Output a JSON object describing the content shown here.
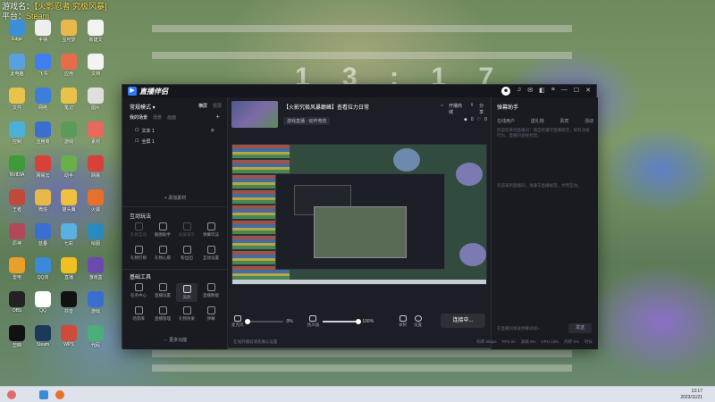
{
  "desktop": {
    "title_line1_label": "游戏名：",
    "title_line1_value": "【火影忍者 究极风暴]",
    "title_line2_label": "平台：",
    "title_line2_value": "Steam",
    "clock": "1 3 : 1 7",
    "icons": [
      {
        "label": "Edge",
        "color": "#3b8ed8"
      },
      {
        "label": "手柄",
        "color": "#eeeeee"
      },
      {
        "label": "宝可梦",
        "color": "#e8b94a"
      },
      {
        "label": "新建文",
        "color": "#f3f3f3"
      },
      {
        "label": "此电脑",
        "color": "#5aa0e0"
      },
      {
        "label": "飞书",
        "color": "#3f7ef0"
      },
      {
        "label": "应用",
        "color": "#e56b4a"
      },
      {
        "label": "文档",
        "color": "#f3f3f3"
      },
      {
        "label": "文件",
        "color": "#e8c24a"
      },
      {
        "label": "网络",
        "color": "#3d7fd8"
      },
      {
        "label": "笔记",
        "color": "#e8c24a"
      },
      {
        "label": "图片",
        "color": "#e0e0e0"
      },
      {
        "label": "控制",
        "color": "#4ab0d8"
      },
      {
        "label": "应用商",
        "color": "#3a6fd0"
      },
      {
        "label": "游戏",
        "color": "#5b9b5a"
      },
      {
        "label": "素材",
        "color": "#e86a5a"
      },
      {
        "label": "NVIDIA",
        "color": "#3e9a3a"
      },
      {
        "label": "网易云",
        "color": "#d8403a"
      },
      {
        "label": "助手",
        "color": "#6ab04a"
      },
      {
        "label": "网易",
        "color": "#d8403a"
      },
      {
        "label": "王者",
        "color": "#c04a3a"
      },
      {
        "label": "微信",
        "color": "#e8b94a"
      },
      {
        "label": "猫头鹰",
        "color": "#f0c040"
      },
      {
        "label": "火狐",
        "color": "#e8702a"
      },
      {
        "label": "原神",
        "color": "#b04a5a"
      },
      {
        "label": "蓝叠",
        "color": "#3a6fd0"
      },
      {
        "label": "七彩",
        "color": "#5ab0e0"
      },
      {
        "label": "绘图",
        "color": "#2a8ac0"
      },
      {
        "label": "雷电",
        "color": "#e8a02a"
      },
      {
        "label": "QQ浏",
        "color": "#3a8ad8"
      },
      {
        "label": "直播",
        "color": "#f0c020"
      },
      {
        "label": "游戏盒",
        "color": "#6a4ab0"
      },
      {
        "label": "OBS",
        "color": "#222222"
      },
      {
        "label": "QQ",
        "color": "#ffffff"
      },
      {
        "label": "抖音",
        "color": "#111111"
      },
      {
        "label": "游戏",
        "color": "#3a6fd0"
      },
      {
        "label": "剪映",
        "color": "#111111"
      },
      {
        "label": "Steam",
        "color": "#1b3a5a"
      },
      {
        "label": "WPS",
        "color": "#d04a3a"
      },
      {
        "label": "代码",
        "color": "#4ab07a"
      }
    ]
  },
  "app": {
    "name": "直播伴侣",
    "left": {
      "mode_label": "常规模式 ▾",
      "orient_h": "横屏",
      "orient_v": "竖屏",
      "scene_tabs": [
        "我的场景",
        "场景",
        "画面"
      ],
      "sources": [
        {
          "label": "文本 1",
          "check": "☐"
        },
        {
          "label": "全屏 1",
          "check": "☐"
        }
      ],
      "add_material": "+ 添加素材",
      "interact_title": "互动玩法",
      "interact_items": [
        {
          "label": "礼物互动",
          "dim": true
        },
        {
          "label": "截图助手",
          "dim": false
        },
        {
          "label": "投屏演示",
          "dim": true
        },
        {
          "label": "弹幕玩法",
          "dim": false
        },
        {
          "label": "礼物打榜",
          "dim": false
        },
        {
          "label": "礼物心愿",
          "dim": false
        },
        {
          "label": "粉丝团",
          "dim": false
        },
        {
          "label": "互动设置",
          "dim": false
        }
      ],
      "basic_title": "基础工具",
      "basic_items": [
        {
          "label": "任务中心",
          "sel": false
        },
        {
          "label": "直播设置",
          "sel": false
        },
        {
          "label": "美颜",
          "sel": true
        },
        {
          "label": "直播数据",
          "sel": false
        },
        {
          "label": "场景库",
          "sel": false
        },
        {
          "label": "直播管理",
          "sel": false
        },
        {
          "label": "礼物效果",
          "sel": false
        },
        {
          "label": "弹幕",
          "sel": false
        }
      ],
      "more_tools": "⋯ 更多功能"
    },
    "center": {
      "live_title": "【火影究极风暴巅峰】查看拉力日常",
      "category": "游戏直播 · 动作竞技",
      "open_shop": "开播商城",
      "share": "分享",
      "viewers": "0",
      "likes": "0",
      "audio": {
        "mic_label": "麦克风",
        "mic_pct": "0%",
        "speaker_label": "扬声器",
        "speaker_pct": "100%",
        "mic_level": 0,
        "speaker_level": 1,
        "record_label": "录制",
        "settings_label": "设置"
      },
      "start_button": "连接中...",
      "status_bar": {
        "hint": "在线开播前请先确认设置",
        "items": [
          "码率 0kbps",
          "FPS 60",
          "丢帧 0%",
          "CPU 13%",
          "内存 0%",
          "时长"
        ]
      }
    },
    "right": {
      "title": "弹幕助手",
      "tabs": [
        "在线用户",
        "送礼物",
        "贵宾",
        "活动"
      ],
      "note1": "欢迎您来到直播间！请自觉遵守直播规范，如有违规行为，直播间会被封禁。",
      "note2": "欢迎来到直播间，请遵守直播规范，文明互动。",
      "input_placeholder": "在直播间发送弹幕试试~",
      "send_label": "发送"
    }
  },
  "taskbar": {
    "time": "13:17",
    "date": "2023/11/21"
  }
}
